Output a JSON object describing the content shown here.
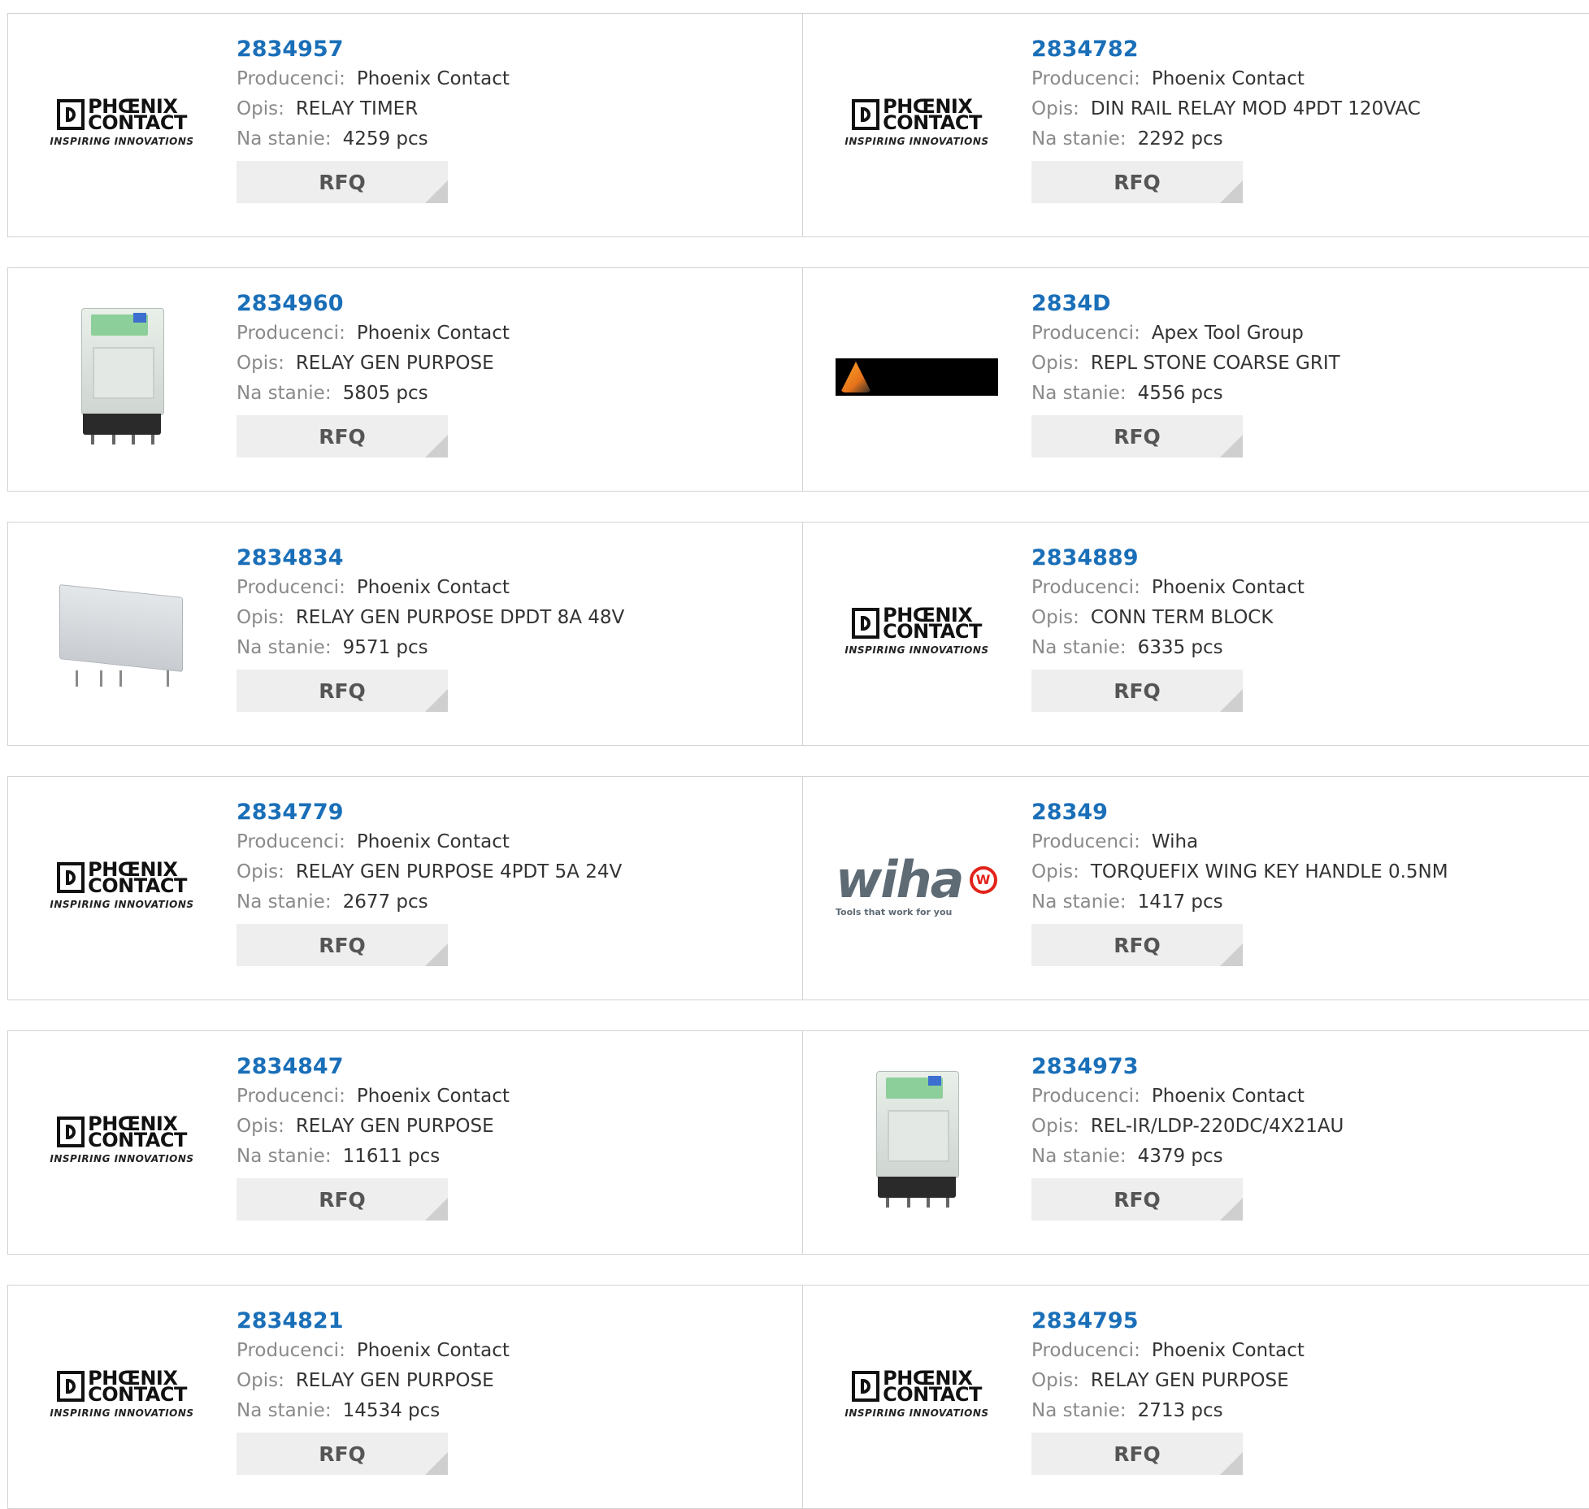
{
  "labels": {
    "manufacturer": "Producenci:",
    "description": "Opis:",
    "stock": "Na stanie:",
    "rfq": "RFQ"
  },
  "logos": {
    "phoenix": {
      "line1": "PHŒNIX",
      "line2": "CONTACT",
      "tagline": "INSPIRING INNOVATIONS"
    },
    "wiha": {
      "word": "wiha",
      "badge": "W",
      "tagline": "Tools that work for you"
    }
  },
  "colors": {
    "part_link": "#1a6fb8",
    "label": "#8a8a8a",
    "border": "#d3d3d3",
    "button_bg": "#eeeeee"
  },
  "products": [
    {
      "part": "2834957",
      "manufacturer": "Phoenix Contact",
      "description": "RELAY TIMER",
      "stock": "4259 pcs",
      "image": "phoenix-logo"
    },
    {
      "part": "2834782",
      "manufacturer": "Phoenix Contact",
      "description": "DIN RAIL RELAY MOD 4PDT 120VAC",
      "stock": "2292 pcs",
      "image": "phoenix-logo"
    },
    {
      "part": "2834960",
      "manufacturer": "Phoenix Contact",
      "description": "RELAY GEN PURPOSE",
      "stock": "5805 pcs",
      "image": "relay-clear"
    },
    {
      "part": "2834D",
      "manufacturer": "Apex Tool Group",
      "description": "REPL STONE COARSE GRIT",
      "stock": "4556 pcs",
      "image": "apex-logo"
    },
    {
      "part": "2834834",
      "manufacturer": "Phoenix Contact",
      "description": "RELAY GEN PURPOSE DPDT 8A 48V",
      "stock": "9571 pcs",
      "image": "relay-grey"
    },
    {
      "part": "2834889",
      "manufacturer": "Phoenix Contact",
      "description": "CONN TERM BLOCK",
      "stock": "6335 pcs",
      "image": "phoenix-logo"
    },
    {
      "part": "2834779",
      "manufacturer": "Phoenix Contact",
      "description": "RELAY GEN PURPOSE 4PDT 5A 24V",
      "stock": "2677 pcs",
      "image": "phoenix-logo"
    },
    {
      "part": "28349",
      "manufacturer": "Wiha",
      "description": "TORQUEFIX WING KEY HANDLE 0.5NM",
      "stock": "1417 pcs",
      "image": "wiha-logo"
    },
    {
      "part": "2834847",
      "manufacturer": "Phoenix Contact",
      "description": "RELAY GEN PURPOSE",
      "stock": "11611 pcs",
      "image": "phoenix-logo"
    },
    {
      "part": "2834973",
      "manufacturer": "Phoenix Contact",
      "description": "REL-IR/LDP-220DC/4X21AU",
      "stock": "4379 pcs",
      "image": "relay-clear"
    },
    {
      "part": "2834821",
      "manufacturer": "Phoenix Contact",
      "description": "RELAY GEN PURPOSE",
      "stock": "14534 pcs",
      "image": "phoenix-logo"
    },
    {
      "part": "2834795",
      "manufacturer": "Phoenix Contact",
      "description": "RELAY GEN PURPOSE",
      "stock": "2713 pcs",
      "image": "phoenix-logo"
    }
  ]
}
